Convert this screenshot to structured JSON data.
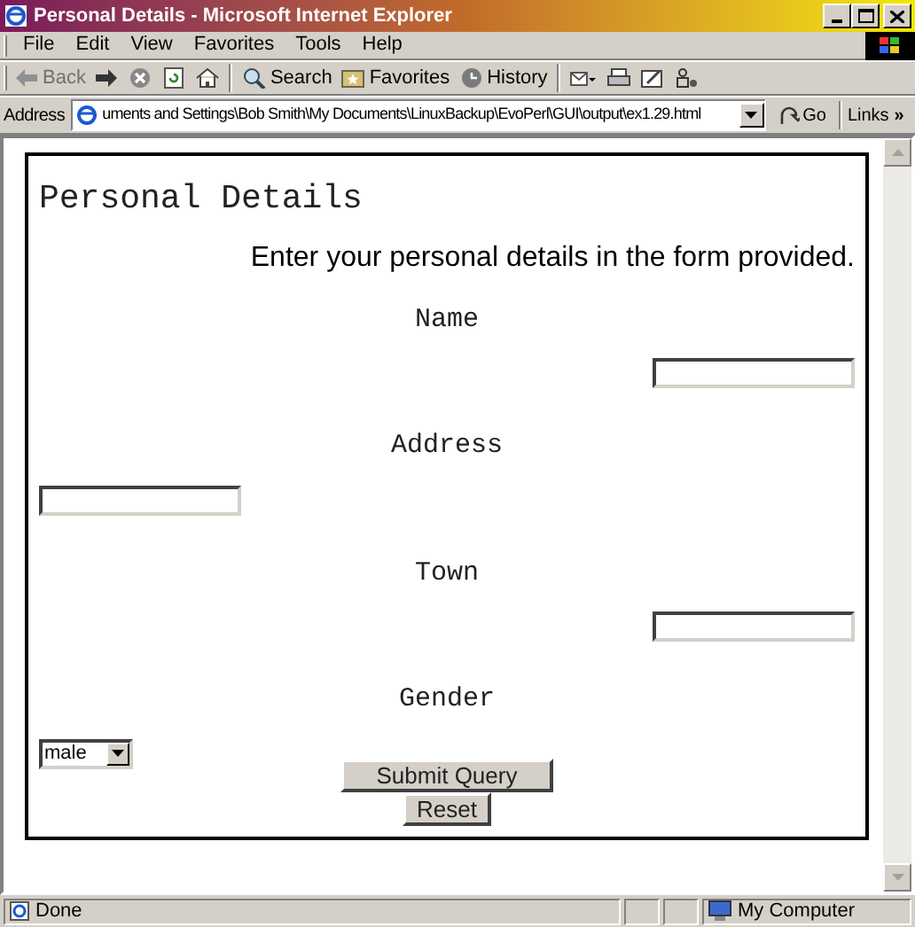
{
  "window": {
    "title": "Personal Details - Microsoft Internet Explorer"
  },
  "menu": [
    "File",
    "Edit",
    "View",
    "Favorites",
    "Tools",
    "Help"
  ],
  "toolbar": [
    {
      "kind": "back",
      "label": "Back",
      "disabled": true
    },
    {
      "kind": "forward",
      "disabled": false
    },
    {
      "kind": "stop",
      "disabled": false
    },
    {
      "kind": "refresh",
      "disabled": false
    },
    {
      "kind": "home",
      "disabled": false
    },
    {
      "kind": "search",
      "label": "Search",
      "disabled": false
    },
    {
      "kind": "favorites",
      "label": "Favorites",
      "disabled": false
    },
    {
      "kind": "history",
      "label": "History",
      "disabled": false
    },
    {
      "kind": "mail",
      "disabled": false
    },
    {
      "kind": "print",
      "disabled": false
    },
    {
      "kind": "edit",
      "disabled": false
    },
    {
      "kind": "messenger",
      "disabled": false
    }
  ],
  "address_bar": {
    "label": "Address",
    "value": "uments and Settings\\Bob Smith\\My Documents\\LinuxBackup\\EvoPerl\\GUI\\output\\ex1.29.html",
    "go": "Go",
    "links": "Links",
    "more": "»"
  },
  "page": {
    "heading": "Personal Details",
    "intro": "Enter your personal details in the form provided.",
    "fields": [
      {
        "label": "Name",
        "kind": "text"
      },
      {
        "label": "Address",
        "kind": "text"
      },
      {
        "label": "Town",
        "kind": "text"
      },
      {
        "label": "Gender",
        "kind": "select",
        "value": "male"
      }
    ],
    "buttons": [
      "Submit Query",
      "Reset"
    ]
  },
  "status_bar": {
    "text": "Done",
    "zone": "My Computer"
  }
}
